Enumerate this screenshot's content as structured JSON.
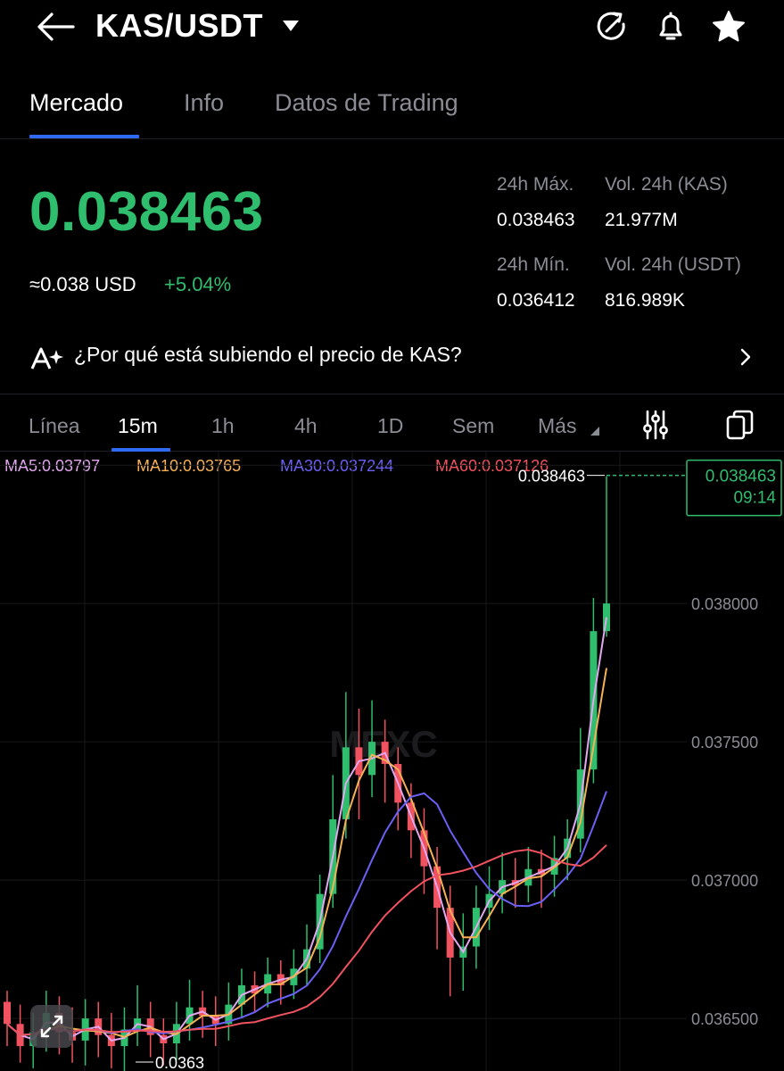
{
  "header": {
    "pair": "KAS/USDT"
  },
  "tabs": [
    {
      "label": "Mercado",
      "active": true
    },
    {
      "label": "Info",
      "active": false
    },
    {
      "label": "Datos de Trading",
      "active": false
    }
  ],
  "ticker": {
    "last_price": "0.038463",
    "usd_approx": "≈0.038 USD",
    "change_pct": "+5.04%",
    "high_label": "24h Máx.",
    "high_value": "0.038463",
    "low_label": "24h Mín.",
    "low_value": "0.036412",
    "vol_base_label": "Vol. 24h (KAS)",
    "vol_base_value": "21.977M",
    "vol_quote_label": "Vol. 24h (USDT)",
    "vol_quote_value": "816.989K"
  },
  "ai_banner": {
    "text": "¿Por qué está subiendo el precio de KAS?"
  },
  "intervals": [
    {
      "label": "Línea",
      "active": false
    },
    {
      "label": "15m",
      "active": true
    },
    {
      "label": "1h",
      "active": false
    },
    {
      "label": "4h",
      "active": false
    },
    {
      "label": "1D",
      "active": false
    },
    {
      "label": "Sem",
      "active": false
    },
    {
      "label": "Más",
      "active": false
    }
  ],
  "moving_averages": [
    {
      "label": "MA5:0.03797",
      "color": "#e2a7ef"
    },
    {
      "label": "MA10:0.03765",
      "color": "#f6b155"
    },
    {
      "label": "MA30:0.037244",
      "color": "#6b60f4"
    },
    {
      "label": "MA60:0.037126",
      "color": "#f1525f"
    }
  ],
  "colors": {
    "up": "#2fbd6e",
    "down": "#f1525f",
    "accent": "#2f6bf2",
    "muted": "#8b8d95"
  },
  "icons": [
    "back-arrow-icon",
    "dropdown-caret-icon",
    "refresh-icon",
    "bell-icon",
    "star-icon",
    "ai-sparkle-icon",
    "chevron-right-icon",
    "indicator-settings-icon",
    "copy-icon",
    "expand-icon"
  ],
  "chart_data": {
    "type": "candlestick",
    "interval": "15m",
    "y_ticks": [
      "0.038500",
      "0.038000",
      "0.037500",
      "0.037000",
      "0.036500"
    ],
    "ylim": [
      0.03631,
      0.03852
    ],
    "last_price_label": "0.038463",
    "last_price_time": "09:14",
    "high_marker": "0.038463",
    "low_marker": "0.0363",
    "candles_approx": [
      [
        0.03656,
        0.03648,
        0.0366,
        0.0364
      ],
      [
        0.03648,
        0.0364,
        0.03655,
        0.03634
      ],
      [
        0.0364,
        0.03645,
        0.03652,
        0.03632
      ],
      [
        0.03645,
        0.03652,
        0.0366,
        0.03638
      ],
      [
        0.03652,
        0.03645,
        0.03658,
        0.03637
      ],
      [
        0.03645,
        0.03642,
        0.03654,
        0.03634
      ],
      [
        0.03642,
        0.0365,
        0.03657,
        0.03633
      ],
      [
        0.0365,
        0.03644,
        0.03656,
        0.03636
      ],
      [
        0.03644,
        0.0364,
        0.03652,
        0.03632
      ],
      [
        0.0364,
        0.03646,
        0.03654,
        0.0363
      ],
      [
        0.03646,
        0.0365,
        0.03662,
        0.0364
      ],
      [
        0.0365,
        0.03644,
        0.03656,
        0.03636
      ],
      [
        0.03644,
        0.03641,
        0.0365,
        0.03633
      ],
      [
        0.03641,
        0.03648,
        0.03656,
        0.03635
      ],
      [
        0.03648,
        0.03654,
        0.03664,
        0.03642
      ],
      [
        0.03654,
        0.03651,
        0.0366,
        0.03643
      ],
      [
        0.03651,
        0.03648,
        0.03658,
        0.0364
      ],
      [
        0.03648,
        0.03655,
        0.03663,
        0.03642
      ],
      [
        0.03655,
        0.03662,
        0.03668,
        0.0365
      ],
      [
        0.03662,
        0.03659,
        0.03667,
        0.03652
      ],
      [
        0.03659,
        0.03666,
        0.03672,
        0.03654
      ],
      [
        0.03666,
        0.03662,
        0.03671,
        0.03655
      ],
      [
        0.03662,
        0.03668,
        0.03675,
        0.03657
      ],
      [
        0.03668,
        0.03675,
        0.03684,
        0.03662
      ],
      [
        0.03675,
        0.03695,
        0.03702,
        0.0367
      ],
      [
        0.03695,
        0.03722,
        0.03738,
        0.0369
      ],
      [
        0.03722,
        0.03748,
        0.03768,
        0.03715
      ],
      [
        0.03748,
        0.03738,
        0.03762,
        0.03722
      ],
      [
        0.03738,
        0.0375,
        0.03765,
        0.0373
      ],
      [
        0.0375,
        0.03742,
        0.03758,
        0.03728
      ],
      [
        0.03742,
        0.03728,
        0.03748,
        0.03718
      ],
      [
        0.03728,
        0.03718,
        0.03735,
        0.03708
      ],
      [
        0.03718,
        0.03705,
        0.03726,
        0.03695
      ],
      [
        0.03705,
        0.0369,
        0.03712,
        0.03675
      ],
      [
        0.0369,
        0.03672,
        0.03698,
        0.03658
      ],
      [
        0.03672,
        0.03676,
        0.03688,
        0.0366
      ],
      [
        0.03676,
        0.0369,
        0.03698,
        0.03668
      ],
      [
        0.0369,
        0.03695,
        0.03705,
        0.03682
      ],
      [
        0.03695,
        0.037,
        0.0371,
        0.03688
      ],
      [
        0.037,
        0.03698,
        0.03708,
        0.0369
      ],
      [
        0.03698,
        0.03704,
        0.03712,
        0.03692
      ],
      [
        0.03704,
        0.03702,
        0.03711,
        0.0369
      ],
      [
        0.03702,
        0.03708,
        0.03716,
        0.03694
      ],
      [
        0.03708,
        0.03715,
        0.03722,
        0.037
      ],
      [
        0.03715,
        0.0374,
        0.03755,
        0.0371
      ],
      [
        0.0374,
        0.0379,
        0.03802,
        0.03735
      ],
      [
        0.0379,
        0.038,
        0.03846,
        0.03788
      ]
    ]
  }
}
